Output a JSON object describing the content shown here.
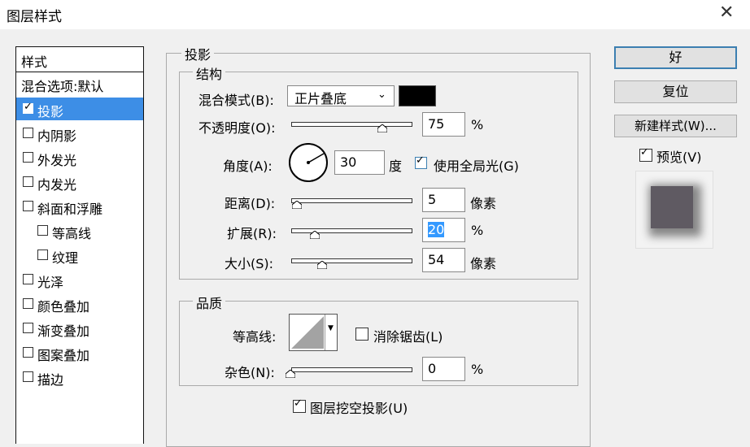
{
  "window": {
    "title": "图层样式"
  },
  "list": {
    "header": "样式",
    "items": [
      {
        "label": "混合选项:默认",
        "checkbox": false,
        "checked": false,
        "indent": 0,
        "selected": false
      },
      {
        "label": "投影",
        "checkbox": true,
        "checked": true,
        "indent": 0,
        "selected": true
      },
      {
        "label": "内阴影",
        "checkbox": true,
        "checked": false,
        "indent": 0,
        "selected": false
      },
      {
        "label": "外发光",
        "checkbox": true,
        "checked": false,
        "indent": 0,
        "selected": false
      },
      {
        "label": "内发光",
        "checkbox": true,
        "checked": false,
        "indent": 0,
        "selected": false
      },
      {
        "label": "斜面和浮雕",
        "checkbox": true,
        "checked": false,
        "indent": 0,
        "selected": false
      },
      {
        "label": "等高线",
        "checkbox": true,
        "checked": false,
        "indent": 1,
        "selected": false
      },
      {
        "label": "纹理",
        "checkbox": true,
        "checked": false,
        "indent": 1,
        "selected": false
      },
      {
        "label": "光泽",
        "checkbox": true,
        "checked": false,
        "indent": 0,
        "selected": false
      },
      {
        "label": "颜色叠加",
        "checkbox": true,
        "checked": false,
        "indent": 0,
        "selected": false
      },
      {
        "label": "渐变叠加",
        "checkbox": true,
        "checked": false,
        "indent": 0,
        "selected": false
      },
      {
        "label": "图案叠加",
        "checkbox": true,
        "checked": false,
        "indent": 0,
        "selected": false
      },
      {
        "label": "描边",
        "checkbox": true,
        "checked": false,
        "indent": 0,
        "selected": false
      }
    ]
  },
  "shadow": {
    "title": "投影",
    "structure": {
      "title": "结构",
      "blend_mode_label": "混合模式(B):",
      "blend_mode_value": "正片叠底",
      "shadow_color": "#000000",
      "opacity_label": "不透明度(O):",
      "opacity_value": "75",
      "opacity_unit": "%",
      "opacity_fraction": 0.75,
      "angle_label": "角度(A):",
      "angle_value": "30",
      "angle_unit": "度",
      "global_light_label": "使用全局光(G)",
      "global_light_checked": true,
      "distance_label": "距离(D):",
      "distance_value": "5",
      "distance_unit": "像素",
      "spread_label": "扩展(R):",
      "spread_value": "20",
      "spread_unit": "%",
      "size_label": "大小(S):",
      "size_value": "54",
      "size_unit": "像素"
    },
    "quality": {
      "title": "品质",
      "contour_label": "等高线:",
      "antialias_label": "消除锯齿(L)",
      "antialias_checked": false,
      "noise_label": "杂色(N):",
      "noise_value": "0",
      "noise_unit": "%"
    },
    "knockout_label": "图层挖空投影(U)",
    "knockout_checked": true
  },
  "buttons": {
    "ok": "好",
    "reset": "复位",
    "new_style": "新建样式(W)...",
    "preview_label": "预览(V)",
    "preview_checked": true
  }
}
